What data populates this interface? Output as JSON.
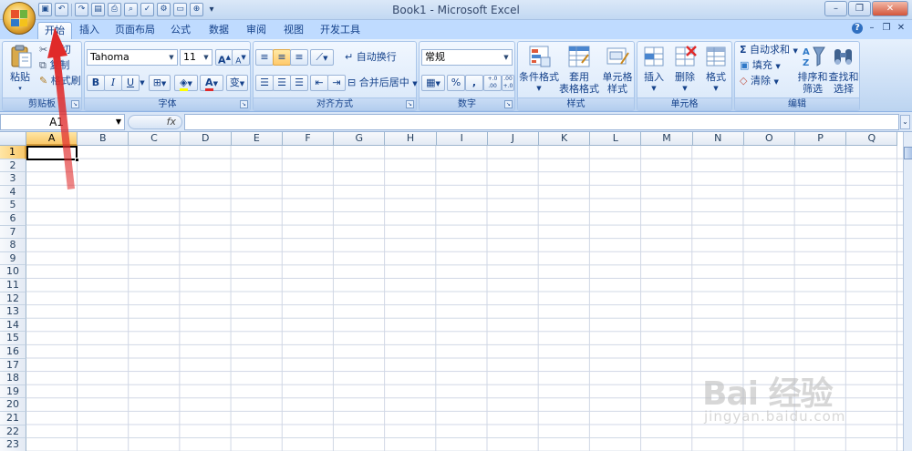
{
  "window": {
    "title": "Book1 - Microsoft Excel",
    "buttons": [
      "–",
      "❐",
      "✕"
    ]
  },
  "quick_access": {
    "save_icon": "save-icon",
    "undo_icon": "undo-icon",
    "redo_icon": "redo-icon",
    "more_icons": [
      "print-preview-icon",
      "print-icon",
      "find-icon",
      "spelling-icon",
      "format-icon",
      "screenshot-icon",
      "link-icon"
    ]
  },
  "tabs": [
    {
      "label": "开始",
      "active": true
    },
    {
      "label": "插入"
    },
    {
      "label": "页面布局"
    },
    {
      "label": "公式"
    },
    {
      "label": "数据"
    },
    {
      "label": "审阅"
    },
    {
      "label": "视图"
    },
    {
      "label": "开发工具"
    }
  ],
  "ribbon": {
    "clipboard": {
      "paste": "粘贴",
      "cut": "剪切",
      "copy": "复制",
      "format_painter": "格式刷",
      "group_label": "剪贴板"
    },
    "font": {
      "font_name": "Tahoma",
      "font_size": "11",
      "bold": "B",
      "italic": "I",
      "underline": "U",
      "phonetic": "变",
      "group_label": "字体"
    },
    "alignment": {
      "wrap_text": "自动换行",
      "merge_center": "合并后居中",
      "group_label": "对齐方式"
    },
    "number": {
      "format": "常规",
      "percent": "%",
      "comma": ",",
      "inc_decimal": "+.0 .00",
      "dec_decimal": ".00 +.0",
      "group_label": "数字"
    },
    "styles": {
      "conditional": "条件格式",
      "table_1": "套用",
      "table_2": "表格格式",
      "cell_1": "单元格",
      "cell_2": "样式",
      "group_label": "样式"
    },
    "cells": {
      "insert": "插入",
      "delete": "删除",
      "format": "格式",
      "group_label": "单元格"
    },
    "editing": {
      "autosum": "自动求和",
      "fill": "填充",
      "clear": "清除",
      "sort_1": "排序和",
      "sort_2": "筛选",
      "find_1": "查找和",
      "find_2": "选择",
      "group_label": "编辑"
    }
  },
  "formula_bar": {
    "name_box": "A1",
    "fx": "fx",
    "formula": ""
  },
  "sheet": {
    "columns": [
      "A",
      "B",
      "C",
      "D",
      "E",
      "F",
      "G",
      "H",
      "I",
      "J",
      "K",
      "L",
      "M",
      "N",
      "O",
      "P",
      "Q"
    ],
    "rows": [
      "1",
      "2",
      "3",
      "4",
      "5",
      "6",
      "7",
      "8",
      "9",
      "10",
      "11",
      "12",
      "13",
      "14",
      "15",
      "16",
      "17",
      "18",
      "19",
      "20",
      "21",
      "22",
      "23"
    ],
    "active_cell": "A1"
  },
  "watermark": {
    "brand": "Bai 经验",
    "url": "jingyan.baidu.com"
  },
  "colors": {
    "ribbon_bg": "#c9ddf5",
    "annotation_arrow": "#e02a2a",
    "active_header": "#f9c86a"
  }
}
